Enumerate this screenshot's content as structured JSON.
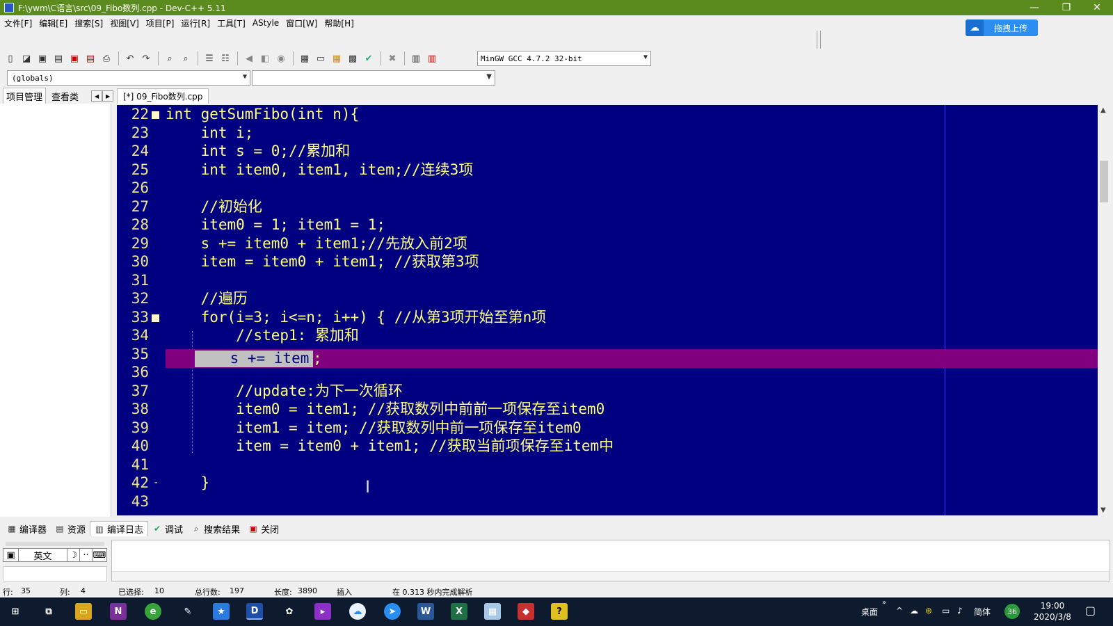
{
  "window": {
    "title": "F:\\ywm\\C语言\\src\\09_Fibo数列.cpp - Dev-C++ 5.11"
  },
  "menu": [
    "文件[F]",
    "编辑[E]",
    "搜索[S]",
    "视图[V]",
    "项目[P]",
    "运行[R]",
    "工具[T]",
    "AStyle",
    "窗口[W]",
    "帮助[H]"
  ],
  "upload_button": "拖拽上传",
  "compiler": "MinGW GCC 4.7.2 32-bit",
  "globals": "(globals)",
  "left_tabs": [
    "项目管理",
    "查看类"
  ],
  "editor_tab": "[*] 09_Fibo数列.cpp",
  "code_lines": [
    {
      "n": "22",
      "text": "int getSumFibo(int n){"
    },
    {
      "n": "23",
      "text": "    int i;"
    },
    {
      "n": "24",
      "text": "    int s = 0;//累加和"
    },
    {
      "n": "25",
      "text": "    int item0, item1, item;//连续3项"
    },
    {
      "n": "26",
      "text": ""
    },
    {
      "n": "27",
      "text": "    //初始化"
    },
    {
      "n": "28",
      "text": "    item0 = 1; item1 = 1;"
    },
    {
      "n": "29",
      "text": "    s += item0 + item1;//先放入前2项"
    },
    {
      "n": "30",
      "text": "    item = item0 + item1; //获取第3项"
    },
    {
      "n": "31",
      "text": ""
    },
    {
      "n": "32",
      "text": "    //遍历"
    },
    {
      "n": "33",
      "text": "    for(i=3; i<=n; i++) { //从第3项开始至第n项"
    },
    {
      "n": "34",
      "text": "        //step1: 累加和"
    },
    {
      "n": "35",
      "text": ""
    },
    {
      "n": "36",
      "text": ""
    },
    {
      "n": "37",
      "text": "        //update:为下一次循环"
    },
    {
      "n": "38",
      "text": "        item0 = item1; //获取数列中前前一项保存至item0"
    },
    {
      "n": "39",
      "text": "        item1 = item; //获取数列中前一项保存至item0"
    },
    {
      "n": "40",
      "text": "        item = item0 + item1; //获取当前项保存至item中"
    },
    {
      "n": "41",
      "text": ""
    },
    {
      "n": "42",
      "text": "    }"
    },
    {
      "n": "43",
      "text": ""
    }
  ],
  "selected_text": "    s += item",
  "selected_tail": ";",
  "bottom_tabs": [
    "编译器",
    "资源",
    "编译日志",
    "调试",
    "搜索结果",
    "关闭"
  ],
  "ime": {
    "lang": "英文"
  },
  "status": {
    "row_label": "行:",
    "row": "35",
    "col_label": "列:",
    "col": "4",
    "selected_label": "已选择:",
    "selected": "10",
    "lines_label": "总行数:",
    "lines": "197",
    "length_label": "长度:",
    "length": "3890",
    "mode": "插入",
    "parse": "在 0.313 秒内完成解析"
  },
  "taskbar": {
    "desktop": "桌面",
    "lang": "简体",
    "badge": "36",
    "time": "19:00",
    "date": "2020/3/8"
  }
}
